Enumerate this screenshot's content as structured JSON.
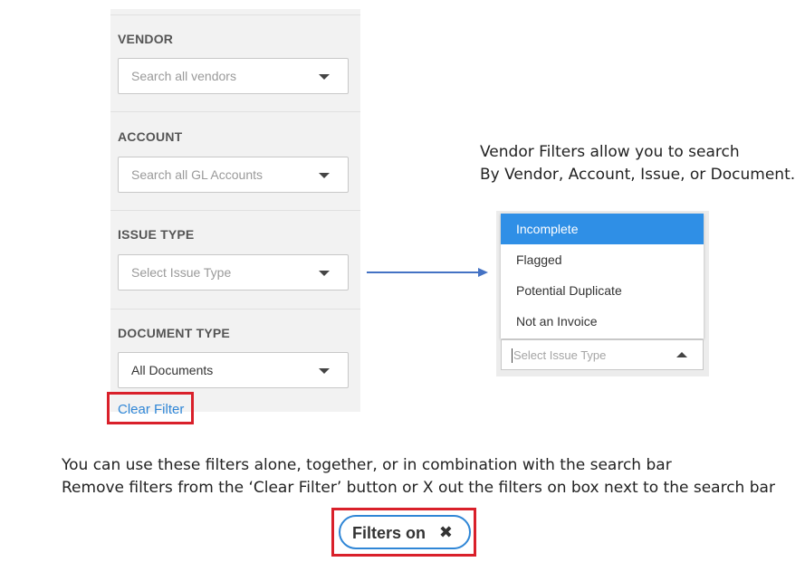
{
  "filter_panel": {
    "vendor": {
      "label": "VENDOR",
      "placeholder": "Search all vendors"
    },
    "account": {
      "label": "ACCOUNT",
      "placeholder": "Search all GL Accounts"
    },
    "issue_type": {
      "label": "ISSUE TYPE",
      "placeholder": "Select Issue Type"
    },
    "document_type": {
      "label": "DOCUMENT TYPE",
      "value": "All Documents"
    },
    "clear_filter": "Clear Filter"
  },
  "description": {
    "line1": "Vendor Filters allow you to search",
    "line2": "By Vendor, Account, Issue, or Document."
  },
  "issue_dropdown": {
    "options": [
      "Incomplete",
      "Flagged",
      "Potential Duplicate",
      "Not an Invoice"
    ],
    "selected": "Incomplete",
    "placeholder": "Select Issue Type"
  },
  "instructions": {
    "line1": "You can use these filters alone, together, or in combination with the search bar",
    "line2": "Remove filters from the ‘Clear Filter’ button or X out the filters on box next to the search bar"
  },
  "filters_chip": {
    "label": "Filters on",
    "close_glyph": "✖"
  },
  "colors": {
    "accent": "#2f86d6",
    "highlight": "#d9202a",
    "active_item": "#2f8fe6",
    "arrow": "#4472c4"
  }
}
